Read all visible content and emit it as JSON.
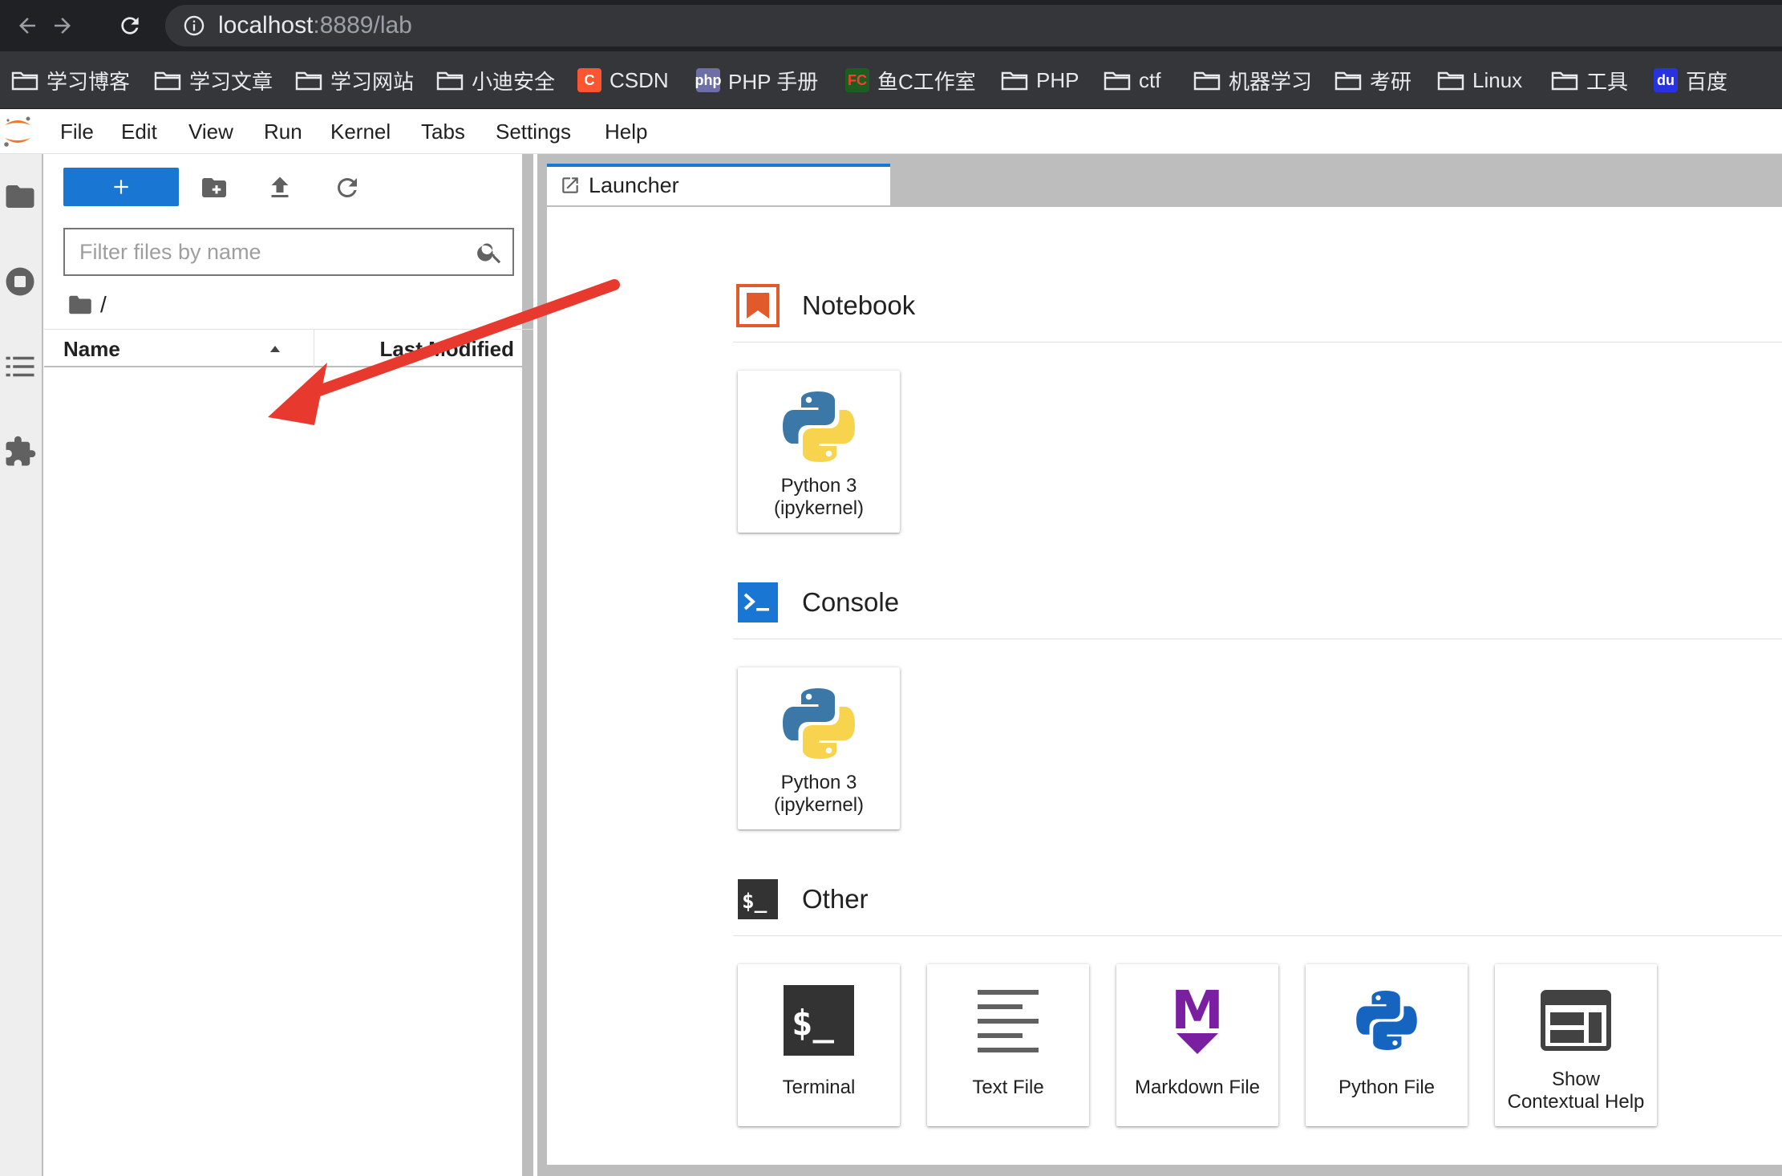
{
  "browser": {
    "url_host": "localhost",
    "url_rest": ":8889/lab",
    "bookmarks": [
      {
        "label": "学习博客",
        "icon": "folder-icon"
      },
      {
        "label": "学习文章",
        "icon": "folder-icon"
      },
      {
        "label": "学习网站",
        "icon": "folder-icon"
      },
      {
        "label": "小迪安全",
        "icon": "folder-icon"
      },
      {
        "label": "CSDN",
        "icon": "csdn-icon",
        "badge": "C"
      },
      {
        "label": "PHP 手册",
        "icon": "php-icon",
        "badge": "php"
      },
      {
        "label": "鱼C工作室",
        "icon": "fishc-icon",
        "badge": "FC"
      },
      {
        "label": "PHP",
        "icon": "folder-icon"
      },
      {
        "label": "ctf",
        "icon": "folder-icon"
      },
      {
        "label": "机器学习",
        "icon": "folder-icon"
      },
      {
        "label": "考研",
        "icon": "folder-icon"
      },
      {
        "label": "Linux",
        "icon": "folder-icon"
      },
      {
        "label": "工具",
        "icon": "folder-icon"
      },
      {
        "label": "百度",
        "icon": "baidu-icon",
        "badge": "du"
      }
    ]
  },
  "menubar": {
    "items": [
      "File",
      "Edit",
      "View",
      "Run",
      "Kernel",
      "Tabs",
      "Settings",
      "Help"
    ]
  },
  "filebrowser": {
    "filter_placeholder": "Filter files by name",
    "path": "/",
    "columns": {
      "name": "Name",
      "modified": "Last Modified"
    }
  },
  "tabs": [
    {
      "label": "Launcher",
      "active": true
    }
  ],
  "launcher": {
    "sections": [
      {
        "title": "Notebook",
        "cards": [
          {
            "label": "Python 3\n(ipykernel)",
            "icon": "python-logo-icon"
          }
        ]
      },
      {
        "title": "Console",
        "cards": [
          {
            "label": "Python 3\n(ipykernel)",
            "icon": "python-logo-icon"
          }
        ]
      },
      {
        "title": "Other",
        "cards": [
          {
            "label": "Terminal",
            "icon": "terminal-icon"
          },
          {
            "label": "Text File",
            "icon": "text-file-icon"
          },
          {
            "label": "Markdown File",
            "icon": "markdown-icon"
          },
          {
            "label": "Python File",
            "icon": "python-file-icon"
          },
          {
            "label": "Show\nContextual Help",
            "icon": "contextual-help-icon"
          }
        ]
      }
    ]
  },
  "colors": {
    "accent": "#1976d2",
    "notebook": "#e05a2c",
    "console": "#1976d2",
    "arrow": "#e8392e"
  }
}
